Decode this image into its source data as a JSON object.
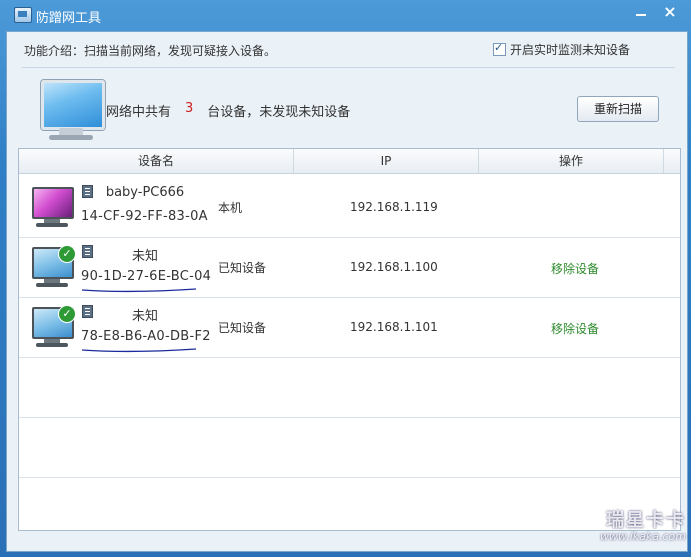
{
  "window": {
    "title": "防蹭网工具",
    "minimize_glyph": "—",
    "close_glyph": "×"
  },
  "header": {
    "intro": "功能介绍：扫描当前网络，发现可疑接入设备。",
    "realtime_monitor_label": "开启实时监测未知设备",
    "realtime_monitor_checked": true
  },
  "summary": {
    "prefix": "网络中共有",
    "count": "3",
    "suffix": "台设备，未发现未知设备",
    "rescan_label": "重新扫描"
  },
  "table": {
    "columns": [
      "设备名",
      "IP",
      "操作"
    ],
    "rows": [
      {
        "host": "baby-PC666",
        "mac": "14-CF-92-FF-83-0A",
        "status": "本机",
        "ip": "192.168.1.119",
        "action": "",
        "icon": "mac-monitor-icon",
        "verified": false,
        "underlined": false
      },
      {
        "host": "未知",
        "mac": "90-1D-27-6E-BC-04",
        "status": "已知设备",
        "ip": "192.168.1.100",
        "action": "移除设备",
        "icon": "monitor-icon",
        "verified": true,
        "underlined": true
      },
      {
        "host": "未知",
        "mac": "78-E8-B6-A0-DB-F2",
        "status": "已知设备",
        "ip": "192.168.1.101",
        "action": "移除设备",
        "icon": "monitor-icon",
        "verified": true,
        "underlined": true
      }
    ]
  },
  "watermark": {
    "main": "瑞星卡卡",
    "sub": "www.ikaka.com"
  },
  "colors": {
    "titlebar": "#2f7fc6",
    "count": "#d02020",
    "action_link": "#2d8a2d",
    "underline_ink": "#1a2a9c"
  }
}
